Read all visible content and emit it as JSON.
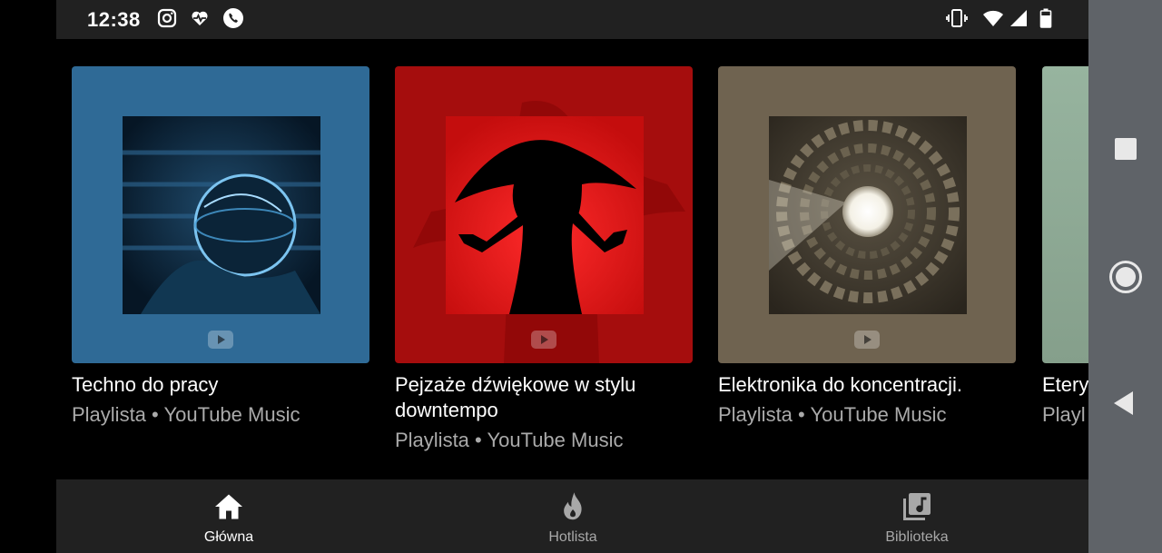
{
  "status_bar": {
    "time": "12:38",
    "left_icons": [
      "instagram-icon",
      "heart-pulse-icon",
      "phone-icon"
    ],
    "right_icons": [
      "vibrate-icon",
      "wifi-icon",
      "signal-icon",
      "battery-icon"
    ]
  },
  "playlists": [
    {
      "title": "Techno do pracy",
      "subtitle": "Playlista • YouTube Music",
      "color": "#2f6a96"
    },
    {
      "title": "Pejzaże dźwiękowe w stylu downtempo",
      "subtitle": "Playlista • YouTube Music",
      "color": "#a50d0d"
    },
    {
      "title": "Elektronika do koncentracji.",
      "subtitle": "Playlista • YouTube Music",
      "color": "#6f6350"
    },
    {
      "title": "Etery",
      "subtitle": "Playl",
      "color": "#8fa995"
    }
  ],
  "bottom_nav": [
    {
      "label": "Główna",
      "icon": "home-icon",
      "active": true
    },
    {
      "label": "Hotlista",
      "icon": "flame-icon",
      "active": false
    },
    {
      "label": "Biblioteka",
      "icon": "library-music-icon",
      "active": false
    }
  ],
  "system_nav": [
    "recents-square-icon",
    "home-circle-icon",
    "back-triangle-icon"
  ],
  "colors": {
    "active": "#ffffff",
    "inactive": "#a8a8a8",
    "surface": "#212121"
  }
}
